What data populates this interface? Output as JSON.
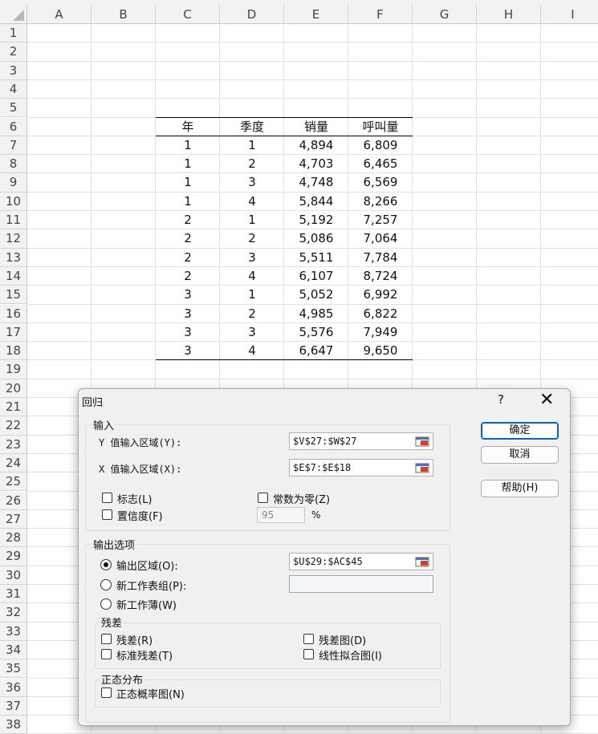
{
  "spreadsheet": {
    "columns": [
      "A",
      "B",
      "C",
      "D",
      "E",
      "F",
      "G",
      "H",
      "I"
    ],
    "rows": [
      "1",
      "2",
      "3",
      "4",
      "5",
      "6",
      "7",
      "8",
      "9",
      "10",
      "11",
      "12",
      "13",
      "14",
      "15",
      "16",
      "17",
      "18",
      "19",
      "20",
      "21",
      "22",
      "23",
      "24",
      "25",
      "26",
      "27",
      "28",
      "29",
      "30",
      "31",
      "32",
      "33",
      "34",
      "35",
      "36",
      "37",
      "38"
    ],
    "table_headers": [
      "年",
      "季度",
      "销量",
      "呼叫量"
    ],
    "table_rows": [
      [
        "1",
        "1",
        "4,894",
        "6,809"
      ],
      [
        "1",
        "2",
        "4,703",
        "6,465"
      ],
      [
        "1",
        "3",
        "4,748",
        "6,569"
      ],
      [
        "1",
        "4",
        "5,844",
        "8,266"
      ],
      [
        "2",
        "1",
        "5,192",
        "7,257"
      ],
      [
        "2",
        "2",
        "5,086",
        "7,064"
      ],
      [
        "2",
        "3",
        "5,511",
        "7,784"
      ],
      [
        "2",
        "4",
        "6,107",
        "8,724"
      ],
      [
        "3",
        "1",
        "5,052",
        "6,992"
      ],
      [
        "3",
        "2",
        "4,985",
        "6,822"
      ],
      [
        "3",
        "3",
        "5,576",
        "7,949"
      ],
      [
        "3",
        "4",
        "6,647",
        "9,650"
      ]
    ]
  },
  "dialog": {
    "title": "回归",
    "help": "?",
    "close": "✕",
    "input_group": "输入",
    "y_range_label": "Y 值输入区域(Y):",
    "y_range_value": "$V$27:$W$27",
    "x_range_label": "X 值输入区域(X):",
    "x_range_value": "$E$7:$E$18",
    "labels_check": "标志(L)",
    "const_zero_check": "常数为零(Z)",
    "confidence_check": "置信度(F)",
    "confidence_value": "95",
    "percent": "%",
    "output_group": "输出选项",
    "output_range_radio": "输出区域(O):",
    "output_range_value": "$U$29:$AC$45",
    "new_sheet_radio": "新工作表组(P):",
    "new_sheet_value": "",
    "new_book_radio": "新工作薄(W)",
    "residual_group": "残差",
    "residuals": "残差(R)",
    "residual_plots": "残差图(D)",
    "std_residuals": "标准残差(T)",
    "line_fit_plots": "线性拟合图(I)",
    "normal_group": "正态分布",
    "normal_plot": "正态概率图(N)",
    "ok_button": "确定",
    "cancel_button": "取消",
    "help_button": "帮助(H)"
  },
  "colors": {
    "primary_border": "#0067c0",
    "dialog_bg": "#f0f0f0",
    "header_bg": "#f2f2f2"
  }
}
